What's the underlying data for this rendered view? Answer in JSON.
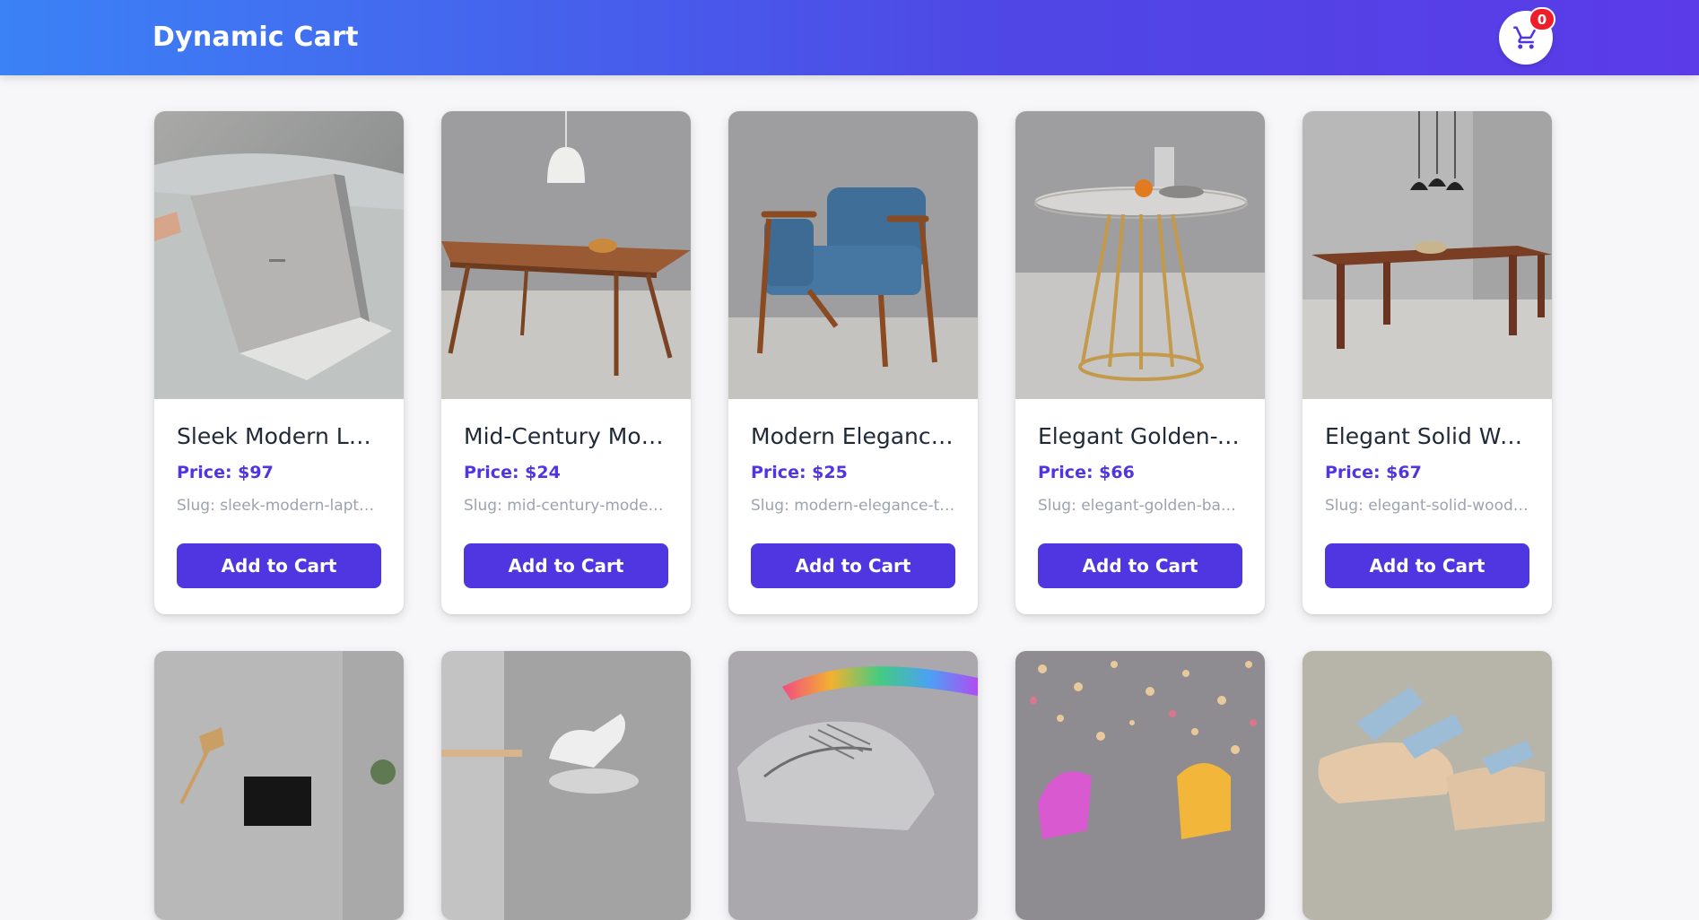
{
  "header": {
    "brand": "Dynamic Cart",
    "cart_count": "0",
    "cart_icon": "shopping-cart-icon"
  },
  "products": [
    {
      "title": "Sleek Modern Lap...",
      "price": "Price: $97",
      "slug": "Slug: sleek-modern-laptop-...",
      "button": "Add to Cart"
    },
    {
      "title": "Mid-Century Mod...",
      "price": "Price: $24",
      "slug": "Slug: mid-century-modern-...",
      "button": "Add to Cart"
    },
    {
      "title": "Modern Elegance ...",
      "price": "Price: $25",
      "slug": "Slug: modern-elegance-teal...",
      "button": "Add to Cart"
    },
    {
      "title": "Elegant Golden-B...",
      "price": "Price: $66",
      "slug": "Slug: elegant-golden-base-...",
      "button": "Add to Cart"
    },
    {
      "title": "Elegant Solid Wo...",
      "price": "Price: $67",
      "slug": "Slug: elegant-solid-wood-d...",
      "button": "Add to Cart"
    }
  ],
  "colors": {
    "accent": "#4f36e0",
    "badge": "#ef1d2a"
  }
}
